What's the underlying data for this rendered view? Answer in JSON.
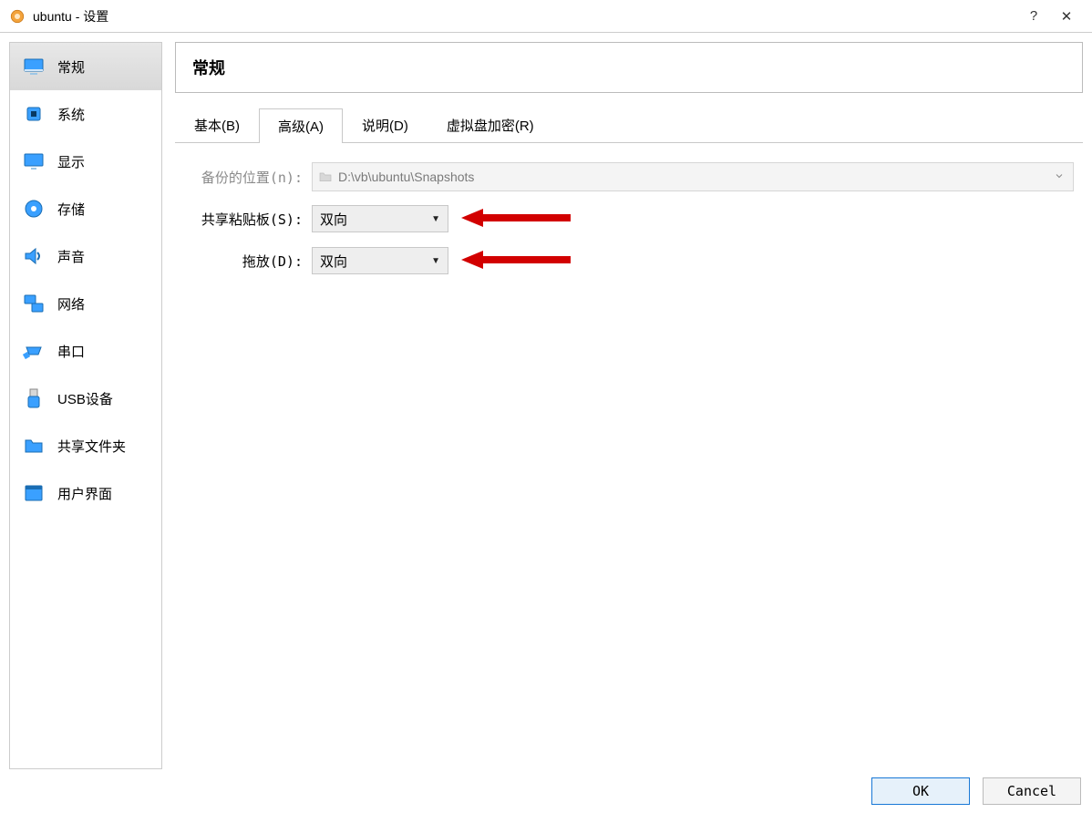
{
  "titlebar": {
    "title": "ubuntu - 设置",
    "help": "?",
    "close": "✕"
  },
  "sidebar": {
    "items": [
      {
        "label": "常规"
      },
      {
        "label": "系统"
      },
      {
        "label": "显示"
      },
      {
        "label": "存储"
      },
      {
        "label": "声音"
      },
      {
        "label": "网络"
      },
      {
        "label": "串口"
      },
      {
        "label": "USB设备"
      },
      {
        "label": "共享文件夹"
      },
      {
        "label": "用户界面"
      }
    ]
  },
  "header": {
    "title": "常规"
  },
  "tabs": {
    "items": [
      {
        "label": "基本(B)"
      },
      {
        "label": "高级(A)"
      },
      {
        "label": "说明(D)"
      },
      {
        "label": "虚拟盘加密(R)"
      }
    ]
  },
  "form": {
    "snapshot_label": "备份的位置(n):",
    "snapshot_path": "D:\\vb\\ubuntu\\Snapshots",
    "clipboard_label": "共享粘贴板(S):",
    "clipboard_value": "双向",
    "dragdrop_label": "拖放(D):",
    "dragdrop_value": "双向"
  },
  "footer": {
    "ok": "OK",
    "cancel": "Cancel"
  }
}
